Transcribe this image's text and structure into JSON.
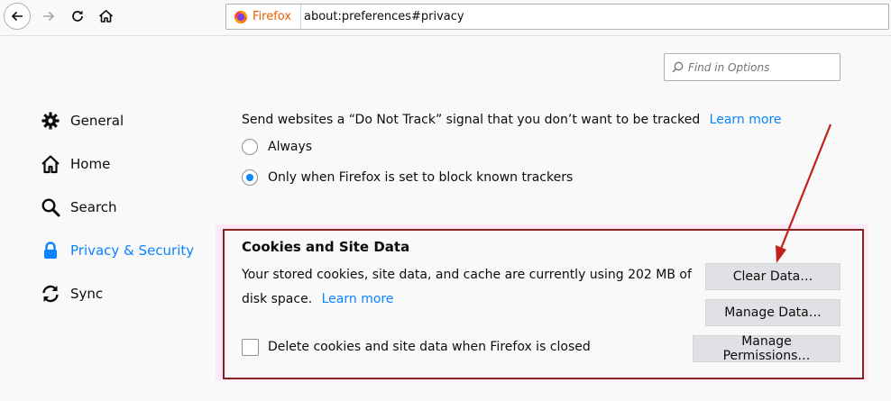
{
  "toolbar": {
    "identity_label": "Firefox",
    "url": "about:preferences#privacy"
  },
  "search": {
    "placeholder": "Find in Options"
  },
  "sidebar": {
    "items": [
      {
        "label": "General",
        "icon": "gear-icon"
      },
      {
        "label": "Home",
        "icon": "home-icon"
      },
      {
        "label": "Search",
        "icon": "search-icon"
      },
      {
        "label": "Privacy & Security",
        "icon": "lock-icon",
        "selected": true
      },
      {
        "label": "Sync",
        "icon": "sync-icon"
      }
    ]
  },
  "dnt": {
    "text": "Send websites a “Do Not Track” signal that you don’t want to be tracked",
    "learn_more": "Learn more",
    "options": [
      {
        "label": "Always",
        "checked": false
      },
      {
        "label": "Only when Firefox is set to block known trackers",
        "checked": true
      }
    ]
  },
  "cookies": {
    "heading": "Cookies and Site Data",
    "description_line1": "Your stored cookies, site data, and cache are currently using 202 MB of",
    "description_line2": "disk space.",
    "learn_more": "Learn more",
    "delete_on_close_label": "Delete cookies and site data when Firefox is closed",
    "delete_on_close_checked": false,
    "buttons": {
      "clear": "Clear Data…",
      "manage": "Manage Data…",
      "permissions": "Manage Permissions…"
    }
  },
  "colors": {
    "accent": "#0a84ff",
    "annotation_border": "#852323",
    "annotation_arrow": "#c0201a"
  }
}
